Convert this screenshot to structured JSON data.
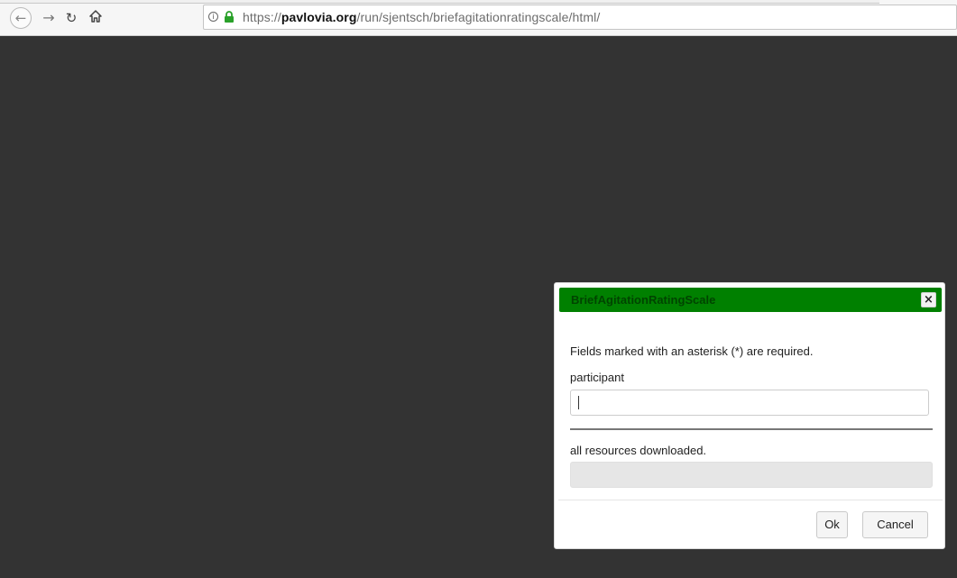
{
  "browser": {
    "url_scheme": "https://",
    "url_host": "pavlovia.org",
    "url_path": "/run/sjentsch/briefagitationratingscale/html/",
    "icons": {
      "back": "back-arrow-icon",
      "forward": "forward-arrow-icon",
      "reload": "reload-icon",
      "home": "home-icon",
      "info": "info-icon",
      "lock": "lock-icon"
    },
    "lock_color": "#2aa12a"
  },
  "dialog": {
    "title": "BriefAgitationRatingScale",
    "title_bar_color": "#008000",
    "close_label": "×",
    "required_note": "Fields marked with an asterisk (*) are required.",
    "field_label": "participant",
    "field_value": "",
    "status": "all resources downloaded.",
    "ok_label": "Ok",
    "cancel_label": "Cancel"
  }
}
